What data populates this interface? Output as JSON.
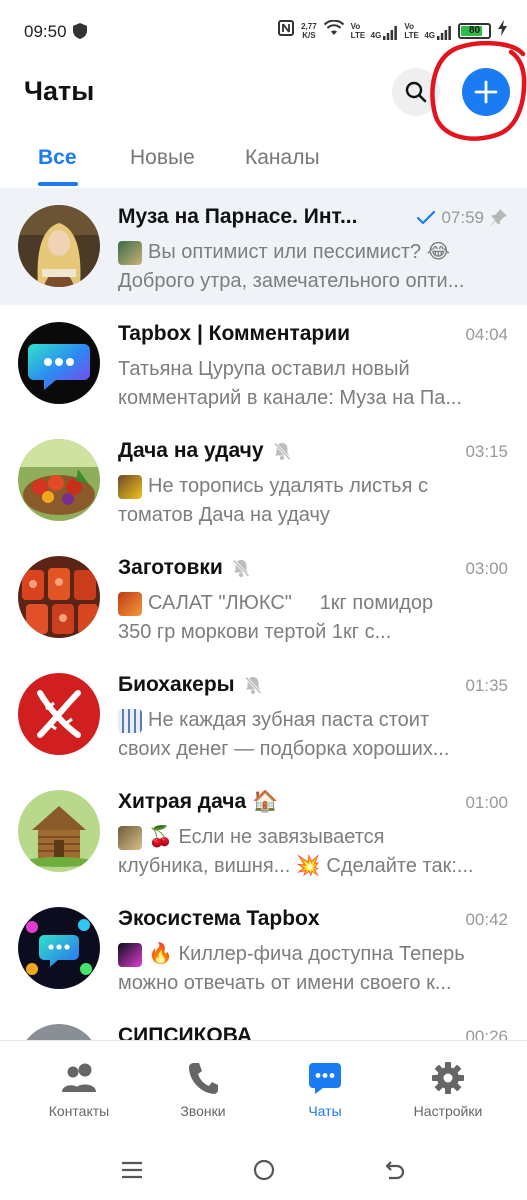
{
  "status_bar": {
    "time": "09:50",
    "net_speed_value": "2,77",
    "net_speed_unit": "K/S",
    "sim1": "Vo LTE",
    "sim2": "Vo LTE",
    "lte1": "4G",
    "lte2": "4G",
    "battery": "80",
    "battery_level": 0.8
  },
  "header": {
    "title": "Чаты"
  },
  "tabs": [
    {
      "label": "Все",
      "active": true
    },
    {
      "label": "Новые",
      "active": false
    },
    {
      "label": "Каналы",
      "active": false
    }
  ],
  "chats": [
    {
      "name": "Муза на Парнасе. Инт...",
      "time": "07:59",
      "read": true,
      "pinned": true,
      "muted": false,
      "preview_line1": "Вы оптимист или пессимист? 😂",
      "preview_line2": "Доброго утра, замечательного опти..."
    },
    {
      "name": "Tapbox | Комментарии",
      "time": "04:04",
      "muted": false,
      "preview_line1": "Татьяна Цурупа оставил новый",
      "preview_line2": "комментарий в канале: Муза на Па..."
    },
    {
      "name": "Дача на удачу",
      "time": "03:15",
      "muted": true,
      "preview_line1": "Не торопись удалять листья с",
      "preview_line2": "томатов Дача на удачу"
    },
    {
      "name": "Заготовки",
      "time": "03:00",
      "muted": true,
      "preview_line1": "САЛАТ \"ЛЮКС\"     1кг помидор",
      "preview_line2": "350 гр моркови тертой 1кг с..."
    },
    {
      "name": "Биохакеры",
      "time": "01:35",
      "muted": true,
      "preview_line1": "Не каждая зубная паста стоит",
      "preview_line2": "своих денег — подборка хороших..."
    },
    {
      "name": "Хитрая дача 🏠",
      "time": "01:00",
      "muted": false,
      "preview_line1": "🍒 Если не завязывается",
      "preview_line2": "клубника, вишня... 💥 Сделайте так:..."
    },
    {
      "name": "Экосистема Tapbox",
      "time": "00:42",
      "muted": false,
      "preview_line1": "🔥 Киллер-фича доступна Теперь",
      "preview_line2": "можно отвечать от имени своего к..."
    },
    {
      "name": "СИПСИКОВА",
      "time": "00:26",
      "muted": false,
      "preview_line1": "",
      "preview_line2": ""
    }
  ],
  "bottom_nav": [
    {
      "label": "Контакты",
      "icon": "contacts-icon",
      "active": false
    },
    {
      "label": "Звонки",
      "icon": "phone-icon",
      "active": false
    },
    {
      "label": "Чаты",
      "icon": "chat-bubble-icon",
      "active": true
    },
    {
      "label": "Настройки",
      "icon": "gear-icon",
      "active": false
    }
  ],
  "colors": {
    "accent": "#1a7bf2",
    "pinned_row_bg": "#eff3f7",
    "annotation_red": "#e3141e"
  }
}
